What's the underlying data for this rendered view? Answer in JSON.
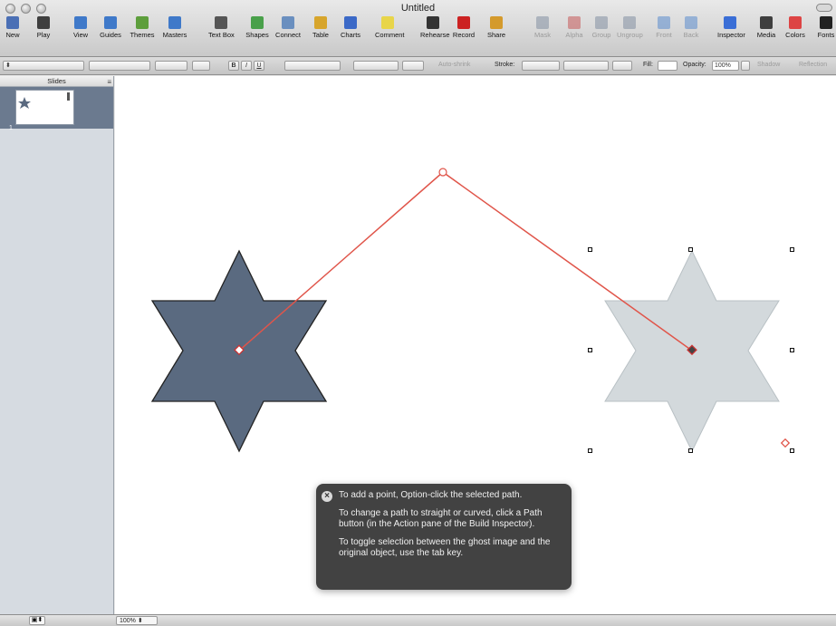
{
  "window": {
    "title": "Untitled"
  },
  "toolbar": {
    "items": [
      {
        "label": "New",
        "icon": "new-icon",
        "color": "#4a6fb5"
      },
      {
        "label": "Play",
        "icon": "play-icon",
        "color": "#3e3e3e"
      },
      {
        "label": "View",
        "icon": "view-icon",
        "color": "#3f79c9"
      },
      {
        "label": "Guides",
        "icon": "guides-icon",
        "color": "#3f79c9"
      },
      {
        "label": "Themes",
        "icon": "themes-icon",
        "color": "#5d9e3c"
      },
      {
        "label": "Masters",
        "icon": "masters-icon",
        "color": "#3f79c9"
      },
      {
        "label": "Text Box",
        "icon": "textbox-icon",
        "color": "#555555"
      },
      {
        "label": "Shapes",
        "icon": "shapes-icon",
        "color": "#49a04a"
      },
      {
        "label": "Connect",
        "icon": "connect-icon",
        "color": "#6a8fbf"
      },
      {
        "label": "Table",
        "icon": "table-icon",
        "color": "#d7a52c"
      },
      {
        "label": "Charts",
        "icon": "charts-icon",
        "color": "#3b69c7"
      },
      {
        "label": "Comment",
        "icon": "comment-icon",
        "color": "#e8d54a"
      },
      {
        "label": "Rehearse",
        "icon": "rehearse-icon",
        "color": "#333333"
      },
      {
        "label": "Record",
        "icon": "record-icon",
        "color": "#cc2222"
      },
      {
        "label": "Share",
        "icon": "share-icon",
        "color": "#d49a2c"
      },
      {
        "label": "Mask",
        "icon": "mask-icon",
        "color": "#6e7f95",
        "dim": true
      },
      {
        "label": "Alpha",
        "icon": "alpha-icon",
        "color": "#c23b3b",
        "dim": true
      },
      {
        "label": "Group",
        "icon": "group-icon",
        "color": "#6e7f95",
        "dim": true
      },
      {
        "label": "Ungroup",
        "icon": "ungroup-icon",
        "color": "#6e7f95",
        "dim": true
      },
      {
        "label": "Front",
        "icon": "front-icon",
        "color": "#3f79c9",
        "dim": true
      },
      {
        "label": "Back",
        "icon": "back-icon",
        "color": "#3f79c9",
        "dim": true
      },
      {
        "label": "Inspector",
        "icon": "inspector-icon",
        "color": "#3a6ed6"
      },
      {
        "label": "Media",
        "icon": "media-icon",
        "color": "#3e3e3e"
      },
      {
        "label": "Colors",
        "icon": "colors-icon",
        "color": "#d44"
      },
      {
        "label": "Fonts",
        "icon": "fonts-icon",
        "color": "#222222"
      }
    ]
  },
  "formatbar": {
    "bold": "B",
    "italic": "I",
    "underline": "U",
    "auto_shrink": "Auto-shrink",
    "stroke_label": "Stroke:",
    "fill_label": "Fill:",
    "opacity_label": "Opacity:",
    "opacity_value": "100%",
    "shadow_label": "Shadow",
    "reflection_label": "Reflection"
  },
  "slides_panel": {
    "header": "Slides",
    "items": [
      {
        "number": "1"
      }
    ]
  },
  "canvas": {
    "star_color": "#5a6a80",
    "ghost_color": "#d3d9dc",
    "path_color": "#e0554a"
  },
  "hud": {
    "line1": "To add a point, Option-click the selected path.",
    "line2": "To change a path to straight or curved, click a Path button (in the Action pane of the Build Inspector).",
    "line3": "To toggle selection between the ghost image and the original object, use the tab key."
  },
  "bottombar": {
    "zoom": "100%"
  }
}
